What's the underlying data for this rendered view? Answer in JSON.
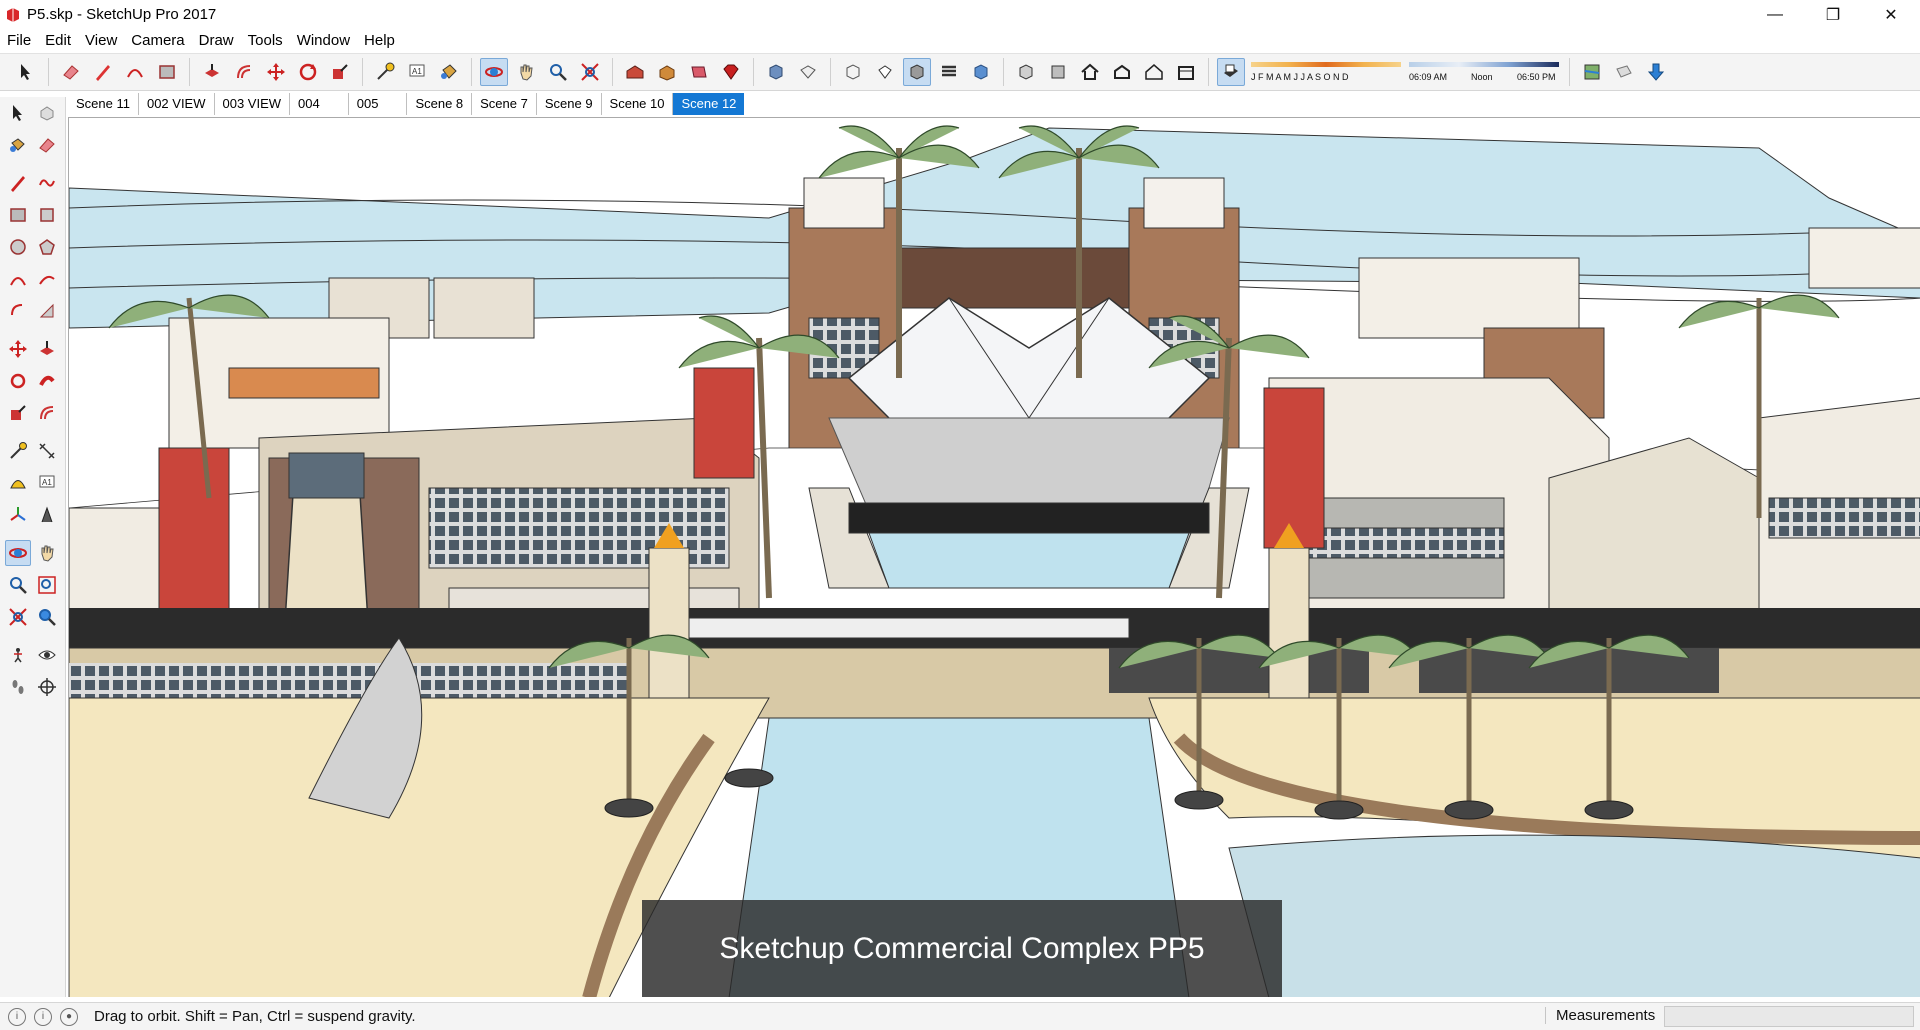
{
  "window": {
    "title": "P5.skp - SketchUp Pro 2017",
    "controls": [
      "—",
      "❐",
      "✕"
    ]
  },
  "menu": [
    "File",
    "Edit",
    "View",
    "Camera",
    "Draw",
    "Tools",
    "Window",
    "Help"
  ],
  "shadow": {
    "months": "J F M A M J J A S O N D",
    "time_start": "06:09 AM",
    "time_mid": "Noon",
    "time_end": "06:50 PM"
  },
  "scenes": {
    "tabs": [
      "Scene 11",
      "002 VIEW",
      "003 VIEW",
      "004",
      "005",
      "Scene 8",
      "Scene 7",
      "Scene 9",
      "Scene 10",
      "Scene 12"
    ],
    "active": "Scene 12"
  },
  "viewport": {
    "caption": "Sketchup Commercial Complex PP5"
  },
  "status": {
    "hint": "Drag to orbit. Shift = Pan, Ctrl = suspend gravity.",
    "measurements_label": "Measurements",
    "measurements_value": ""
  }
}
